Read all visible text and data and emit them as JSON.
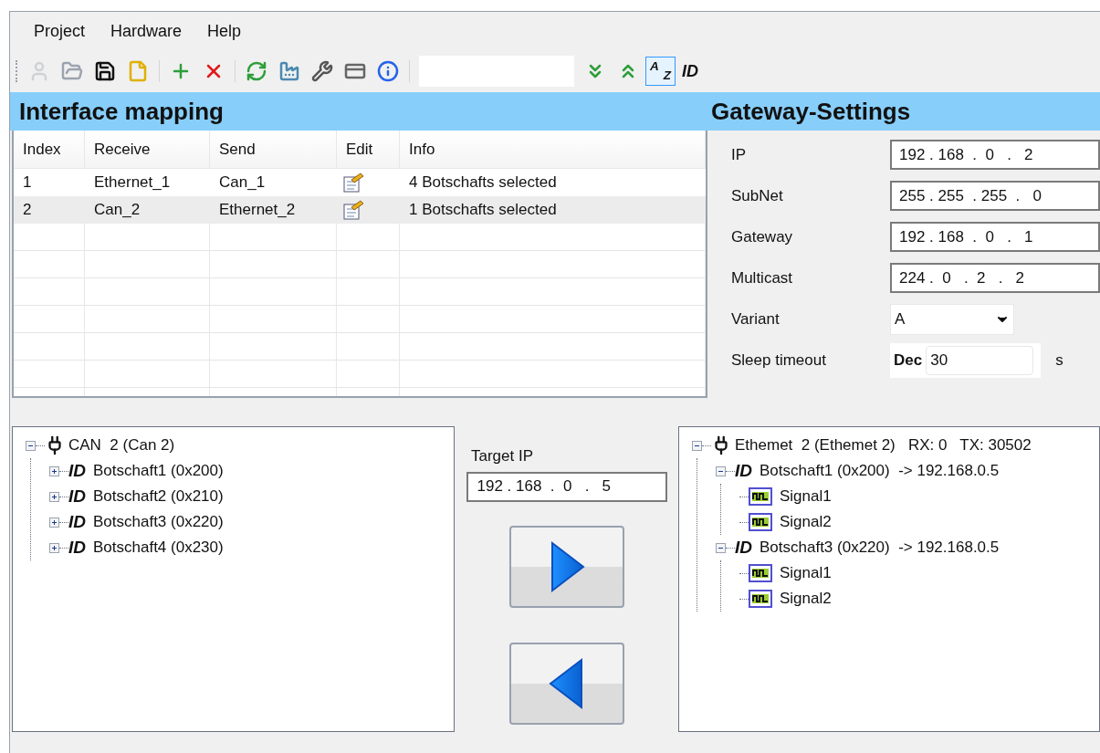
{
  "menu": [
    "Project",
    "Hardware",
    "Help"
  ],
  "toolbar": [
    {
      "kind": "user",
      "disabled": true
    },
    {
      "kind": "open",
      "disabled": false
    },
    {
      "kind": "save",
      "disabled": false
    },
    {
      "kind": "new",
      "disabled": false
    },
    {
      "kind": "sep"
    },
    {
      "kind": "add",
      "disabled": false
    },
    {
      "kind": "delete",
      "disabled": false
    },
    {
      "kind": "sep"
    },
    {
      "kind": "refresh",
      "disabled": false
    },
    {
      "kind": "factory",
      "disabled": false
    },
    {
      "kind": "tools",
      "disabled": false
    },
    {
      "kind": "device",
      "disabled": false
    },
    {
      "kind": "info",
      "disabled": false
    },
    {
      "kind": "sep"
    },
    {
      "kind": "search"
    },
    {
      "kind": "expand",
      "disabled": false
    },
    {
      "kind": "collapse",
      "disabled": false
    },
    {
      "kind": "text",
      "text": "$^{A}$ $_{Z}$",
      "selected": true
    },
    {
      "kind": "text",
      "text": "ID",
      "selected": false
    }
  ],
  "mapping": {
    "title": "Interface mapping",
    "columns": [
      "Index",
      "Receive",
      "Send",
      "Edit",
      "Info"
    ],
    "rows": [
      {
        "index": "1",
        "receive": "Ethernet_1",
        "send": "Can_1",
        "info": "4 Botschafts selected",
        "selected": false
      },
      {
        "index": "2",
        "receive": "Can_2",
        "send": "Ethernet_2",
        "info": "1 Botschafts selected",
        "selected": true
      }
    ]
  },
  "gateway": {
    "title": "Gateway-Settings",
    "fields": [
      {
        "kind": "ip",
        "label": "IP",
        "value": "192 . 168  .  0   .   2"
      },
      {
        "kind": "ip",
        "label": "SubNet",
        "value": "255 . 255  . 255  .   0"
      },
      {
        "kind": "ip",
        "label": "Gateway",
        "value": "192 . 168  .  0   .   1"
      },
      {
        "kind": "ip",
        "label": "Multicast",
        "value": "224 .  0   .  2   .   2"
      },
      {
        "kind": "combo",
        "label": "Variant",
        "value": "A"
      },
      {
        "kind": "number",
        "label": "Sleep timeout",
        "prefix": "Dec",
        "value": "30",
        "unit": "s"
      }
    ]
  },
  "source_tree": [
    {
      "kind": "interface",
      "text": "CAN  2 (Can 2)",
      "expanded": true,
      "children": [
        {
          "kind": "message",
          "badge": "ID",
          "text": "Botschaft1 (0x200)",
          "expanded": false
        },
        {
          "kind": "message",
          "badge": "ID",
          "text": "Botschaft2 (0x210)",
          "expanded": false
        },
        {
          "kind": "message",
          "badge": "ID",
          "text": "Botschaft3 (0x220)",
          "expanded": false
        },
        {
          "kind": "message",
          "badge": "ID",
          "text": "Botschaft4 (0x230)",
          "expanded": false
        }
      ]
    }
  ],
  "target": {
    "label": "Target IP",
    "value": "192 . 168  .  0   .   5"
  },
  "target_tree": [
    {
      "kind": "interface",
      "text": "Ethemet  2 (Ethemet 2)   RX: 0   TX: 30502",
      "expanded": true,
      "children": [
        {
          "kind": "message",
          "badge": "ID",
          "text": "Botschaft1 (0x200)  -> 192.168.0.5",
          "expanded": true,
          "children": [
            {
              "kind": "signal",
              "text": "Signal1"
            },
            {
              "kind": "signal",
              "text": "Signal2"
            }
          ]
        },
        {
          "kind": "message",
          "badge": "ID",
          "text": "Botschaft3 (0x220)  -> 192.168.0.5",
          "expanded": true,
          "children": [
            {
              "kind": "signal",
              "text": "Signal1"
            },
            {
              "kind": "signal",
              "text": "Signal2"
            }
          ]
        }
      ]
    }
  ]
}
